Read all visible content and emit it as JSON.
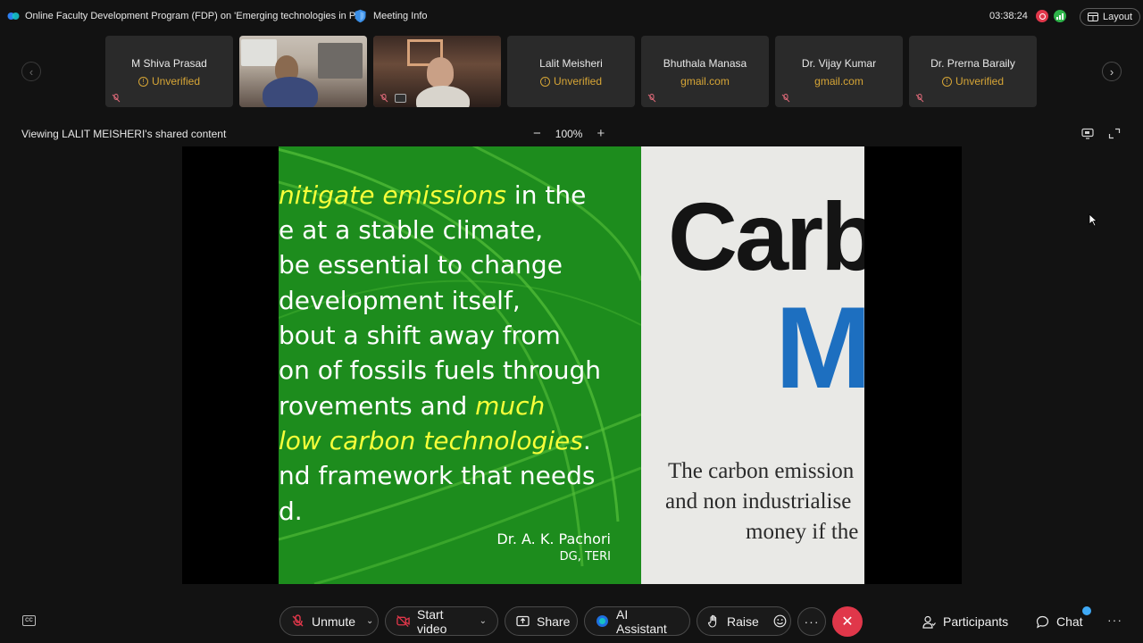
{
  "top_bar": {
    "meeting_title": "Online Faculty Development Program (FDP) on 'Emerging technologies in P...",
    "meeting_info_label": "Meeting Info",
    "elapsed_time": "03:38:24",
    "layout_label": "Layout"
  },
  "participants": [
    {
      "name": "M Shiva Prasad",
      "status": "Unverified",
      "type": "name"
    },
    {
      "name": "",
      "status": "",
      "type": "video"
    },
    {
      "name": "",
      "status": "",
      "type": "video"
    },
    {
      "name": "Lalit Meisheri",
      "status": "Unverified",
      "type": "name"
    },
    {
      "name": "Bhuthala Manasa",
      "status": "gmail.com",
      "type": "name"
    },
    {
      "name": "Dr. Vijay Kumar",
      "status": "gmail.com",
      "type": "name"
    },
    {
      "name": "Dr. Prerna Baraily",
      "status": "Unverified",
      "type": "name"
    }
  ],
  "share_header": {
    "viewing_label": "Viewing LALIT MEISHERI's shared content",
    "zoom_out": "−",
    "zoom_level": "100%",
    "zoom_in": "+"
  },
  "slide": {
    "line1_hl": "nitigate emissions",
    "line1_rest": " in the",
    "line2": "e at a stable climate,",
    "line3": "be essential to change",
    "line4": "development itself,",
    "line5": "bout a shift away from",
    "line6": "on of fossils fuels through",
    "line7_a": "rovements and ",
    "line7_hl": "much",
    "line8_hl": " low carbon technologies",
    "line8_rest": ".",
    "line9": "nd framework that needs",
    "line10": "d.",
    "author": "Dr. A. K. Pachori",
    "author_org": "DG, TERI",
    "paper_big": "Carb",
    "paper_blue": "M",
    "paper_line1": "The carbon emission",
    "paper_line2": "and non industrialise",
    "paper_line3": "money if the"
  },
  "bottom_bar": {
    "unmute_label": "Unmute",
    "start_video_label": "Start video",
    "share_label": "Share",
    "ai_assistant_label": "AI Assistant",
    "raise_label": "Raise",
    "more_label": "···",
    "participants_label": "Participants",
    "chat_label": "Chat",
    "more_right_label": "···"
  },
  "colors": {
    "leave": "#e0374a",
    "unverified": "#d6a536",
    "slide_green": "#1d8c1d",
    "slide_highlight": "#f7ff3a",
    "paper_blue": "#1d6fc0"
  }
}
